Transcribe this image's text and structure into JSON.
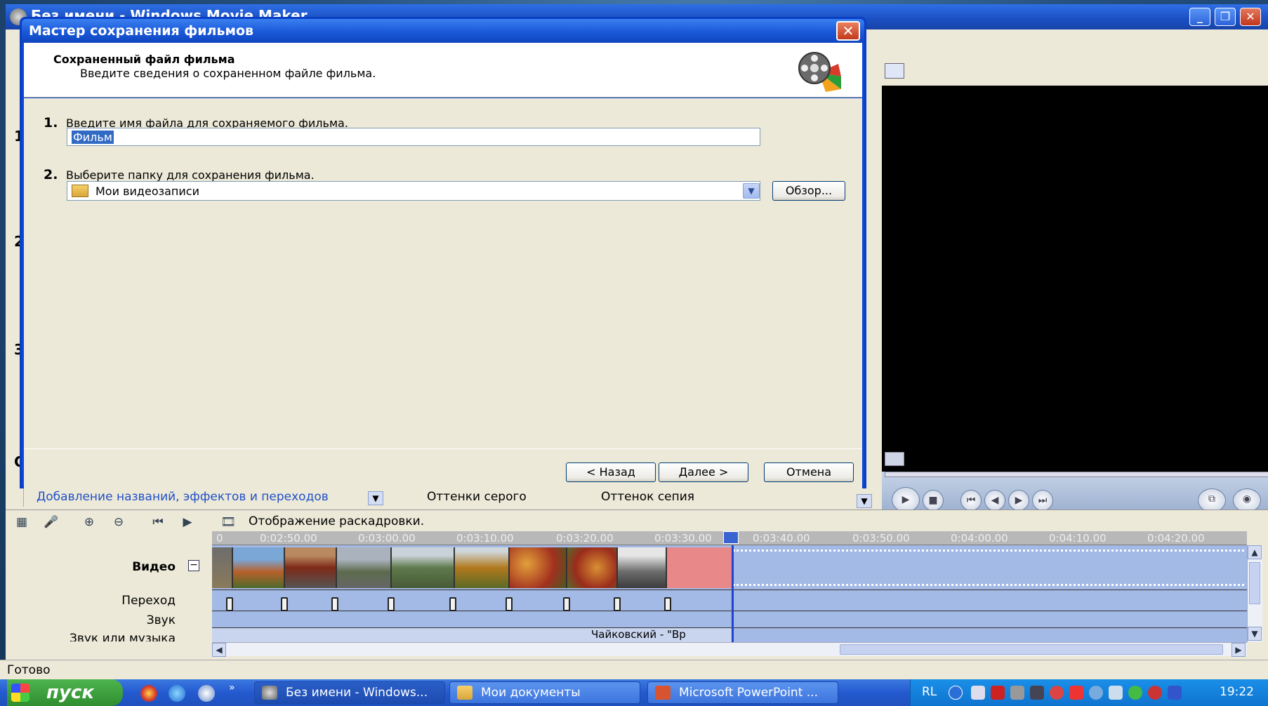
{
  "main_window": {
    "title": "Без имени - Windows Movie Maker",
    "minimize": "_",
    "restore": "❐",
    "close": "✕"
  },
  "left_strip_numbers": [
    "1",
    "2",
    "3",
    "С"
  ],
  "dialog": {
    "title": "Мастер сохранения фильмов",
    "close": "✕",
    "header_title": "Сохраненный файл фильма",
    "header_subtitle": "Введите сведения о сохраненном файле фильма.",
    "step1_number": "1.",
    "step1_label": "Введите имя файла для сохраняемого фильма.",
    "filename_value": "Фильм",
    "step2_number": "2.",
    "step2_label": "Выберите папку для сохранения фильма.",
    "folder_value": "Мои видеозаписи",
    "browse_button": "Обзор...",
    "back_button": "< Назад",
    "next_button": "Далее >",
    "cancel_button": "Отмена"
  },
  "collection_bar": {
    "link": "Добавление названий, эффектов и переходов",
    "item1": "Оттенки серого",
    "item2": "Оттенок сепия"
  },
  "timeline": {
    "storyboard_label": "Отображение раскадровки.",
    "ticks": [
      "0",
      "0:02:50.00",
      "0:03:00.00",
      "0:03:10.00",
      "0:03:20.00",
      "0:03:30.00",
      "0:03:40.00",
      "0:03:50.00",
      "0:04:00.00",
      "0:04:10.00",
      "0:04:20.00"
    ],
    "video_label": "Видео",
    "transition_label": "Переход",
    "audio_label": "Звук",
    "music_label": "Звук или музыка",
    "music_clip": "Чайковский - \"Вр"
  },
  "status": "Готово",
  "taskbar": {
    "start": "пуск",
    "tasks": [
      "Без имени - Windows...",
      "Мои документы",
      "Microsoft PowerPoint ..."
    ],
    "lang": "RL",
    "clock": "19:22"
  },
  "colors": {
    "xp_blue": "#0a48d8",
    "timeline_blue": "#a3b9e6",
    "start_green": "#2f8e2f"
  }
}
